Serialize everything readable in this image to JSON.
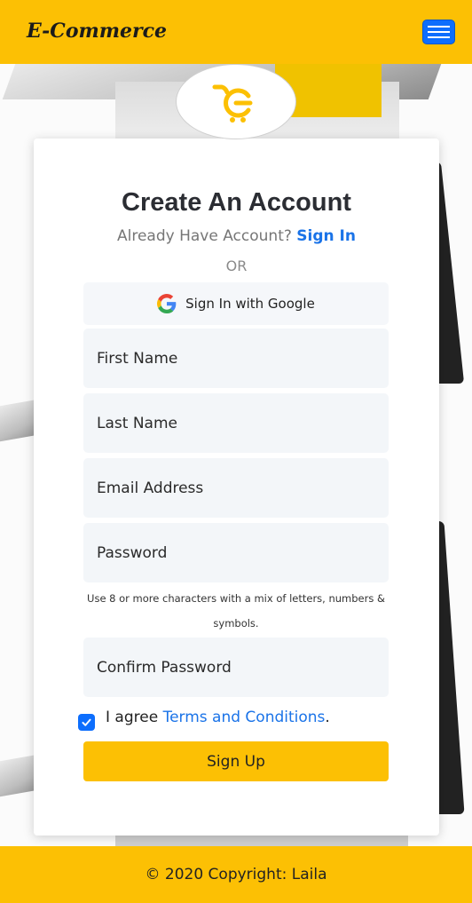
{
  "header": {
    "brand": "E-Commerce",
    "menu_icon": "hamburger-icon",
    "accent_color": "#fcc004",
    "menu_button_color": "#0d6efd"
  },
  "logo": {
    "icon": "cart-logo-icon"
  },
  "form": {
    "title": "Create An Account",
    "have_account_text": "Already Have Account?",
    "sign_in_link": "Sign In",
    "or_text": "OR",
    "google_button_label": "Sign In with Google",
    "google_icon": "google-icon",
    "fields": {
      "first_name_placeholder": "First Name",
      "last_name_placeholder": "Last Name",
      "email_placeholder": "Email Address",
      "password_placeholder": "Password",
      "confirm_password_placeholder": "Confirm Password"
    },
    "password_hint": "Use 8 or more characters with a mix of letters, numbers & symbols.",
    "agree_text": "I agree",
    "terms_link": "Terms and Conditions",
    "terms_period": ".",
    "agree_checked": true,
    "signup_label": "Sign Up"
  },
  "footer": {
    "copyright": "© 2020 Copyright: Laila"
  }
}
